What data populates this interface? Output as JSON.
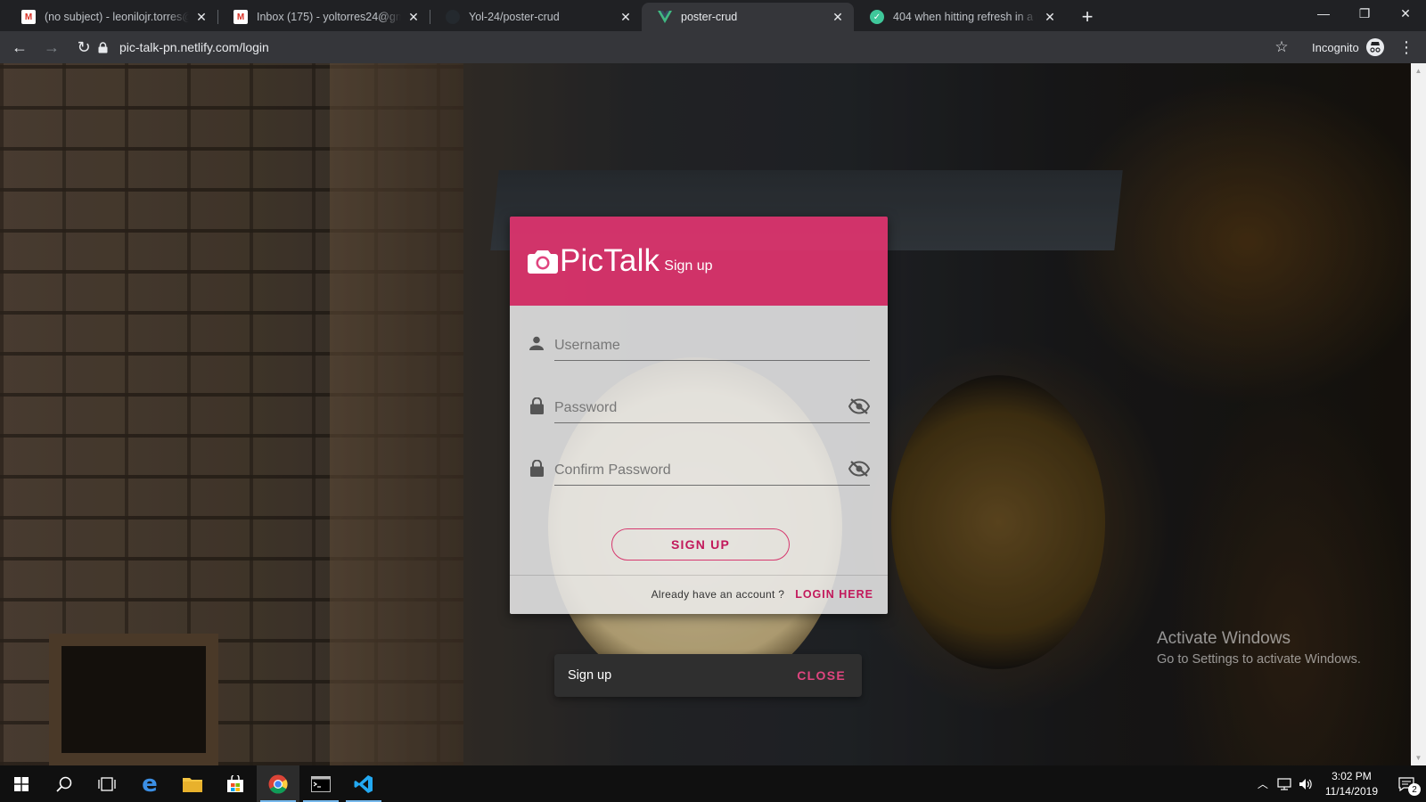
{
  "browser": {
    "tabs": [
      {
        "title": "(no subject) - leonilojr.torres@st",
        "icon": "gmail-icon",
        "active": false
      },
      {
        "title": "Inbox (175) - yoltorres24@gmail",
        "icon": "gmail-icon",
        "active": false
      },
      {
        "title": "Yol-24/poster-crud",
        "icon": "github-icon",
        "active": false
      },
      {
        "title": "poster-crud",
        "icon": "vuejs-icon",
        "active": true
      },
      {
        "title": "404 when hitting refresh in a rou",
        "icon": "netlify-icon",
        "active": false
      }
    ],
    "new_tab_label": "+",
    "url": "pic-talk-pn.netlify.com/login",
    "profile_label": "Incognito"
  },
  "signup_card": {
    "brand": "PicTalk",
    "subtitle": "Sign up",
    "username_placeholder": "Username",
    "password_placeholder": "Password",
    "confirm_password_placeholder": "Confirm Password",
    "submit_label": "SIGN UP",
    "footer_question": "Already have an account ?",
    "login_link_label": "LOGIN HERE",
    "accent_color": "#e0457f"
  },
  "snackbar": {
    "message": "Sign up",
    "action_label": "CLOSE"
  },
  "watermark": {
    "line1": "Activate Windows",
    "line2": "Go to Settings to activate Windows."
  },
  "taskbar": {
    "apps": [
      "windows-start-icon",
      "search-icon",
      "task-view-icon",
      "edge-icon",
      "file-explorer-icon",
      "store-icon",
      "chrome-icon",
      "terminal-icon",
      "vscode-icon"
    ],
    "time": "3:02 PM",
    "date": "11/14/2019",
    "notification_count": "2"
  }
}
